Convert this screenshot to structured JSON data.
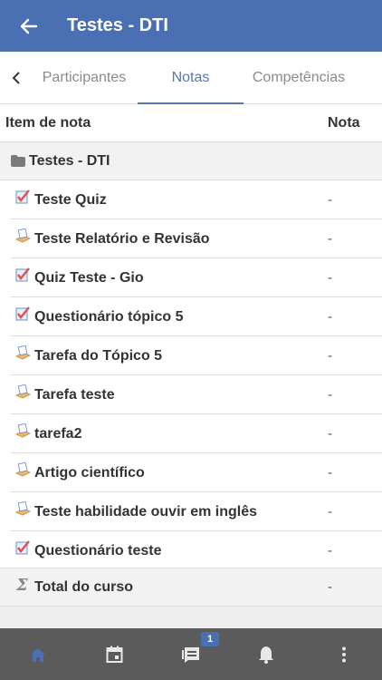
{
  "header": {
    "title": "Testes - DTI"
  },
  "tabs": [
    {
      "label": "Participantes"
    },
    {
      "label": "Notas"
    },
    {
      "label": "Competências"
    }
  ],
  "table": {
    "col_item": "Item de nota",
    "col_grade": "Nota",
    "category": "Testes - DTI",
    "rows": [
      {
        "label": "Teste Quiz",
        "grade": "-",
        "icon": "quiz-icon"
      },
      {
        "label": "Teste Relatório e Revisão",
        "grade": "-",
        "icon": "assignment-icon"
      },
      {
        "label": "Quiz Teste - Gio",
        "grade": "-",
        "icon": "quiz-icon"
      },
      {
        "label": "Questionário tópico 5",
        "grade": "-",
        "icon": "quiz-icon"
      },
      {
        "label": "Tarefa do Tópico 5",
        "grade": "-",
        "icon": "assignment-icon"
      },
      {
        "label": "Tarefa teste",
        "grade": "-",
        "icon": "assignment-icon"
      },
      {
        "label": "tarefa2",
        "grade": "-",
        "icon": "assignment-icon"
      },
      {
        "label": "Artigo científico",
        "grade": "-",
        "icon": "assignment-icon"
      },
      {
        "label": "Teste habilidade ouvir em inglês",
        "grade": "-",
        "icon": "assignment-icon"
      },
      {
        "label": "Questionário teste",
        "grade": "-",
        "icon": "quiz-icon"
      }
    ],
    "total": {
      "label": "Total do curso",
      "grade": "-",
      "symbol": "Σ"
    }
  },
  "bottom_nav": {
    "messages_badge": "1",
    "icons": [
      "home-icon",
      "calendar-icon",
      "messages-icon",
      "bell-icon",
      "more-vertical-icon"
    ]
  },
  "colors": {
    "primary": "#4a6fb3",
    "active_tab": "#5577b4",
    "bottom_bar": "#5b5b5b"
  }
}
